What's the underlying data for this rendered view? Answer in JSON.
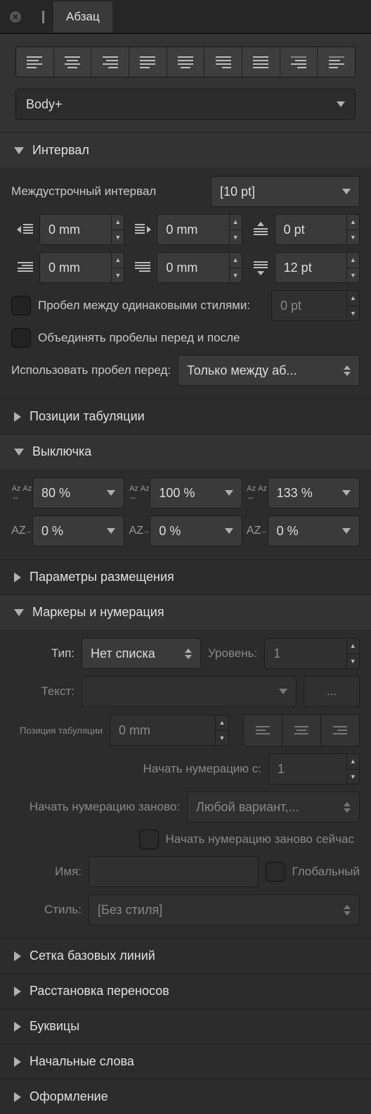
{
  "header": {
    "tab": "Абзац"
  },
  "style": {
    "current": "Body+"
  },
  "sections": {
    "interval": {
      "title": "Интервал",
      "leading_label": "Междустрочный интервал",
      "leading_value": "[10 pt]",
      "indent_left": "0 mm",
      "indent_right": "0 mm",
      "first_line": "0 mm",
      "last_line": "0 mm",
      "space_before": "0 pt",
      "space_after": "12 pt",
      "same_style_label": "Пробел между одинаковыми стилями:",
      "same_style_value": "0 pt",
      "merge_spaces": "Объединять пробелы перед и после",
      "use_space_label": "Использовать пробел перед:",
      "use_space_value": "Только между аб..."
    },
    "tabs": {
      "title": "Позиции табуляции"
    },
    "justify": {
      "title": "Выключка",
      "word_min": "80 %",
      "word_opt": "100 %",
      "word_max": "133 %",
      "letter_min": "0 %",
      "letter_opt": "0 %",
      "letter_max": "0 %"
    },
    "placement": {
      "title": "Параметры размещения"
    },
    "bullets": {
      "title": "Маркеры и нумерация",
      "type_label": "Тип:",
      "type_value": "Нет списка",
      "level_label": "Уровень:",
      "level_value": "1",
      "text_label": "Текст:",
      "text_btn": "...",
      "tabpos_label": "Позиция табуляции",
      "tabpos_value": "0 mm",
      "start_label": "Начать нумерацию с:",
      "start_value": "1",
      "restart_label": "Начать нумерацию заново:",
      "restart_value": "Любой вариант,...",
      "restart_now": "Начать нумерацию заново сейчас",
      "name_label": "Имя:",
      "global_label": "Глобальный",
      "style_label": "Стиль:",
      "style_value": "[Без стиля]"
    },
    "baseline": {
      "title": "Сетка базовых линий"
    },
    "hyphen": {
      "title": "Расстановка переносов"
    },
    "dropcaps": {
      "title": "Буквицы"
    },
    "initwords": {
      "title": "Начальные слова"
    },
    "decor": {
      "title": "Оформление"
    }
  }
}
